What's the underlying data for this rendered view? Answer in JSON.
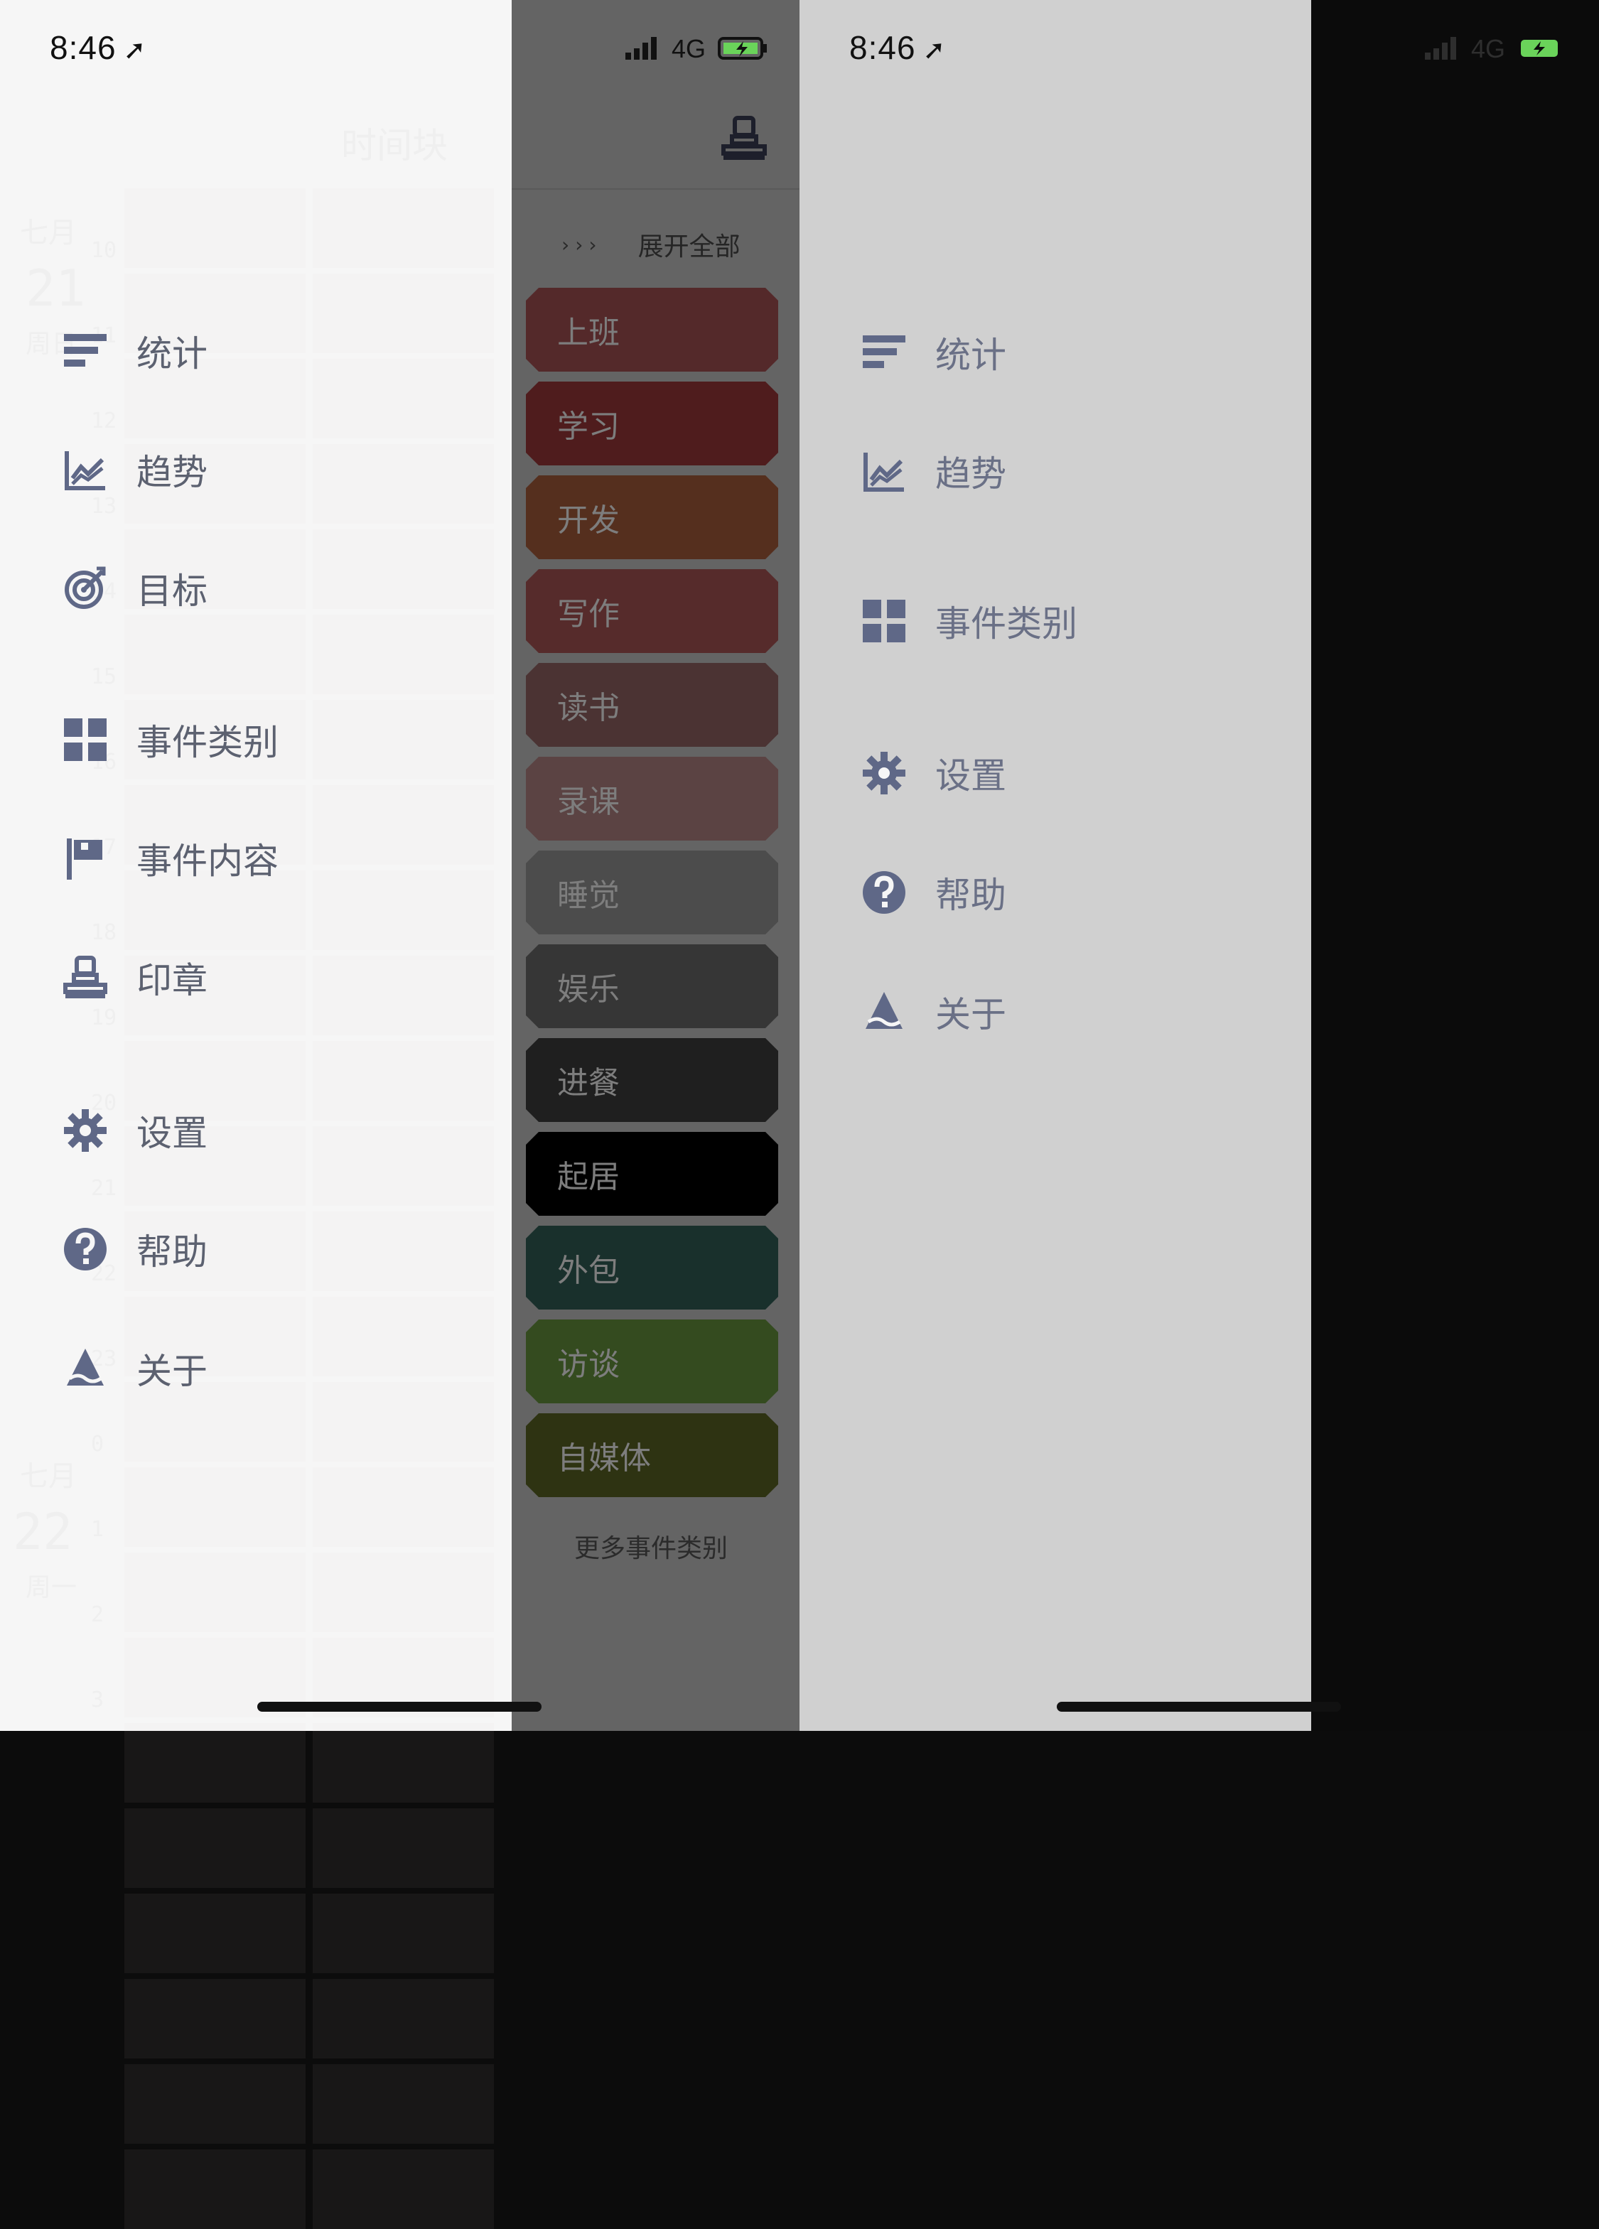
{
  "left": {
    "status": {
      "time": "8:46",
      "network": "4G",
      "battery_color": "#6ad35a"
    },
    "ghost": {
      "title": "时间块",
      "month1": "七月",
      "day1": "21",
      "weekday1": "周日",
      "month2": "七月",
      "day2": "22",
      "weekday2": "周一",
      "hour_labels": [
        "10",
        "11",
        "12",
        "13",
        "14",
        "15",
        "16",
        "17",
        "18",
        "19",
        "20",
        "21",
        "22",
        "23",
        "0",
        "1",
        "2",
        "3"
      ]
    },
    "menu": [
      {
        "label": "统计",
        "icon": "stats-icon"
      },
      {
        "label": "趋势",
        "icon": "trend-icon"
      },
      {
        "label": "目标",
        "icon": "target-icon"
      },
      {
        "label": "事件类别",
        "icon": "grid-icon"
      },
      {
        "label": "事件内容",
        "icon": "flag-icon"
      },
      {
        "label": "印章",
        "icon": "stamp-icon"
      },
      {
        "label": "设置",
        "icon": "gear-icon"
      },
      {
        "label": "帮助",
        "icon": "help-icon"
      },
      {
        "label": "关于",
        "icon": "about-icon"
      }
    ],
    "panel": {
      "header_icon": "stamp-icon",
      "expand_icon": "chevrons-icon",
      "expand_label": "展开全部",
      "categories": [
        {
          "label": "上班",
          "color": "#54292a"
        },
        {
          "label": "学习",
          "color": "#4f1c1d"
        },
        {
          "label": "开发",
          "color": "#552f1e"
        },
        {
          "label": "写作",
          "color": "#562b2b"
        },
        {
          "label": "读书",
          "color": "#4b3333"
        },
        {
          "label": "录课",
          "color": "#5b4343"
        },
        {
          "label": "睡觉",
          "color": "#4c4c4c"
        },
        {
          "label": "娱乐",
          "color": "#363636"
        },
        {
          "label": "进餐",
          "color": "#1f1f1f"
        },
        {
          "label": "起居",
          "color": "#000000"
        },
        {
          "label": "外包",
          "color": "#19302c"
        },
        {
          "label": "访谈",
          "color": "#344b1f"
        },
        {
          "label": "自媒体",
          "color": "#2e3312"
        }
      ],
      "more_label": "更多事件类别"
    }
  },
  "right": {
    "status": {
      "time": "8:46",
      "network": "4G",
      "battery_color": "#6ad35a"
    },
    "menu": [
      {
        "label": "统计",
        "icon": "stats-icon"
      },
      {
        "label": "趋势",
        "icon": "trend-icon"
      },
      {
        "label": "事件类别",
        "icon": "grid-icon"
      },
      {
        "label": "设置",
        "icon": "gear-icon"
      },
      {
        "label": "帮助",
        "icon": "help-icon"
      },
      {
        "label": "关于",
        "icon": "about-icon"
      }
    ]
  },
  "colors": {
    "icon": "#5f6887",
    "left_bg": "#f6f6f6",
    "panel_bg": "#646464",
    "right_bg": "#d0d0d0"
  }
}
